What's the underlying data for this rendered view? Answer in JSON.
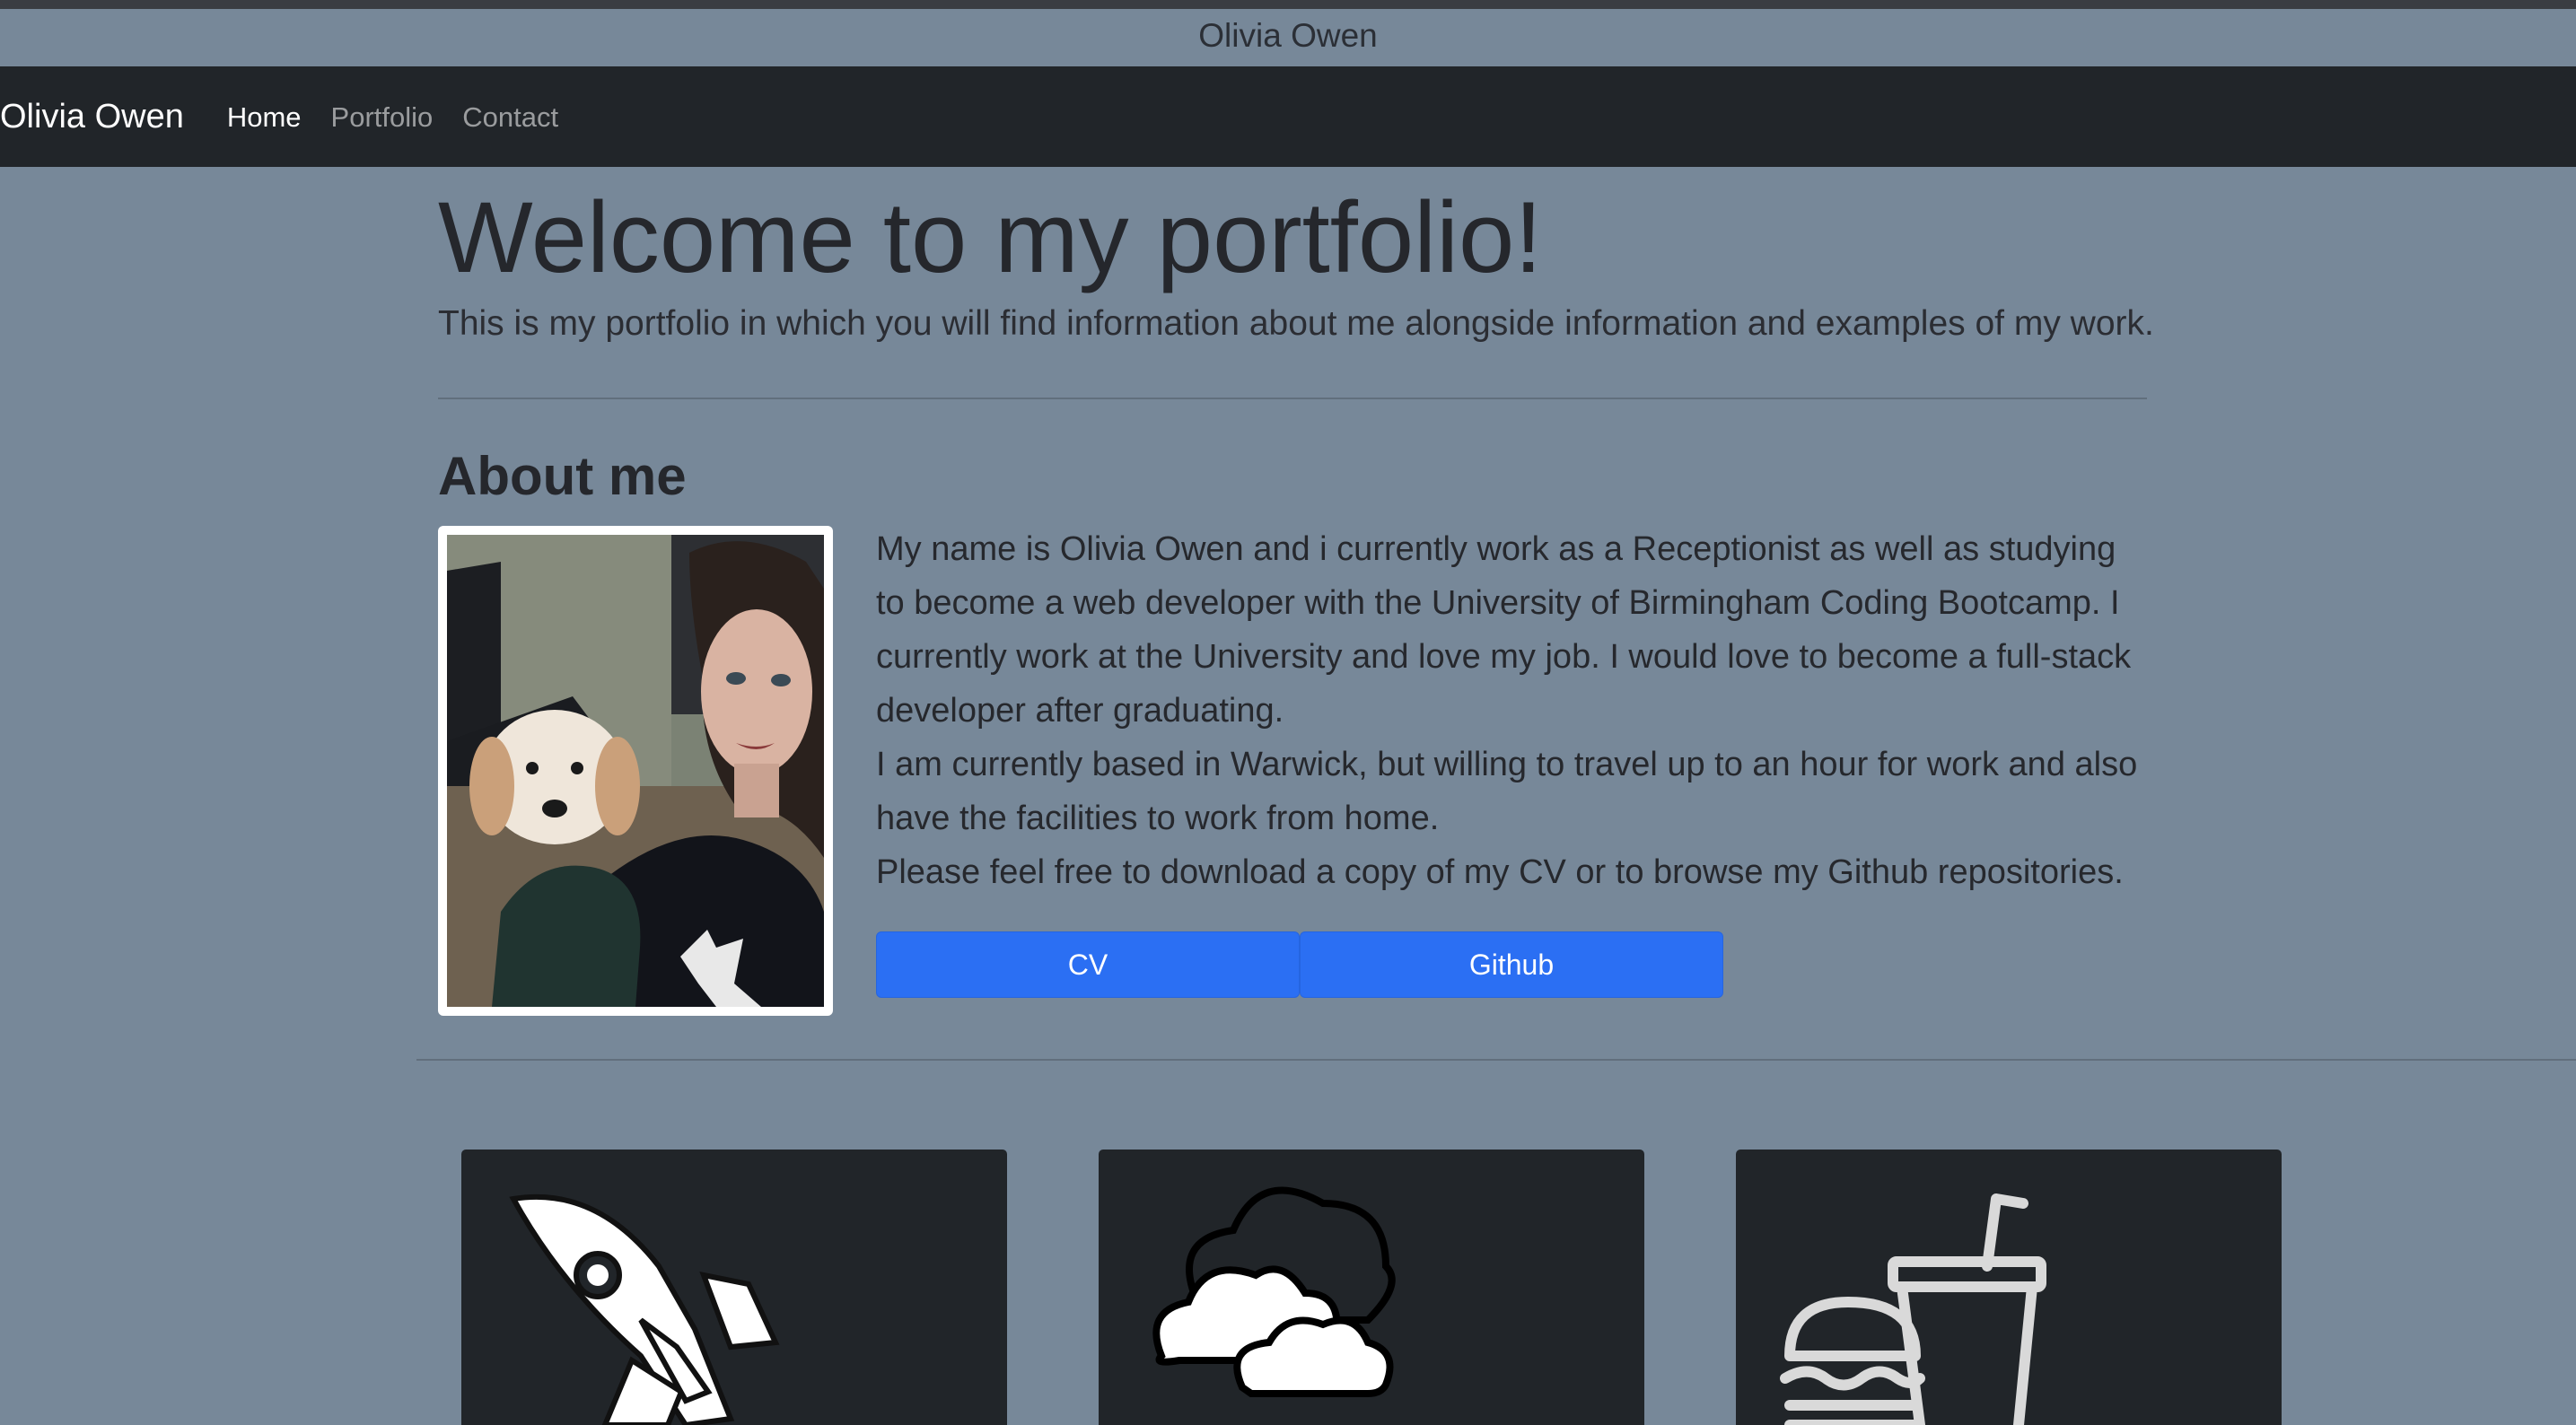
{
  "page_title": "Olivia Owen",
  "navbar": {
    "brand": "Olivia Owen",
    "links": [
      {
        "label": "Home",
        "active": true
      },
      {
        "label": "Portfolio",
        "active": false
      },
      {
        "label": "Contact",
        "active": false
      }
    ]
  },
  "hero": {
    "title": "Welcome to my portfolio!",
    "lead": "This is my portfolio in which you will find information about me alongside information and examples of my work."
  },
  "about": {
    "title": "About me",
    "paragraphs": [
      "My name is Olivia Owen and i currently work as a Receptionist as well as studying to become a web developer with the University of Birmingham Coding Bootcamp. I currently work at the University and love my job. I would love to become a full-stack developer after graduating.",
      "I am currently based in Warwick, but willing to travel up to an hour for work and also have the facilities to work from home.",
      "Please feel free to download a copy of my CV or to browse my Github repositories."
    ],
    "buttons": {
      "cv": "CV",
      "github": "Github"
    }
  },
  "cards": [
    {
      "icon": "rocket-icon"
    },
    {
      "icon": "cloud-icon"
    },
    {
      "icon": "burger-drink-icon"
    }
  ],
  "colors": {
    "background": "#778899",
    "navbar": "#212529",
    "button": "#2b6ff3",
    "card": "#212529"
  }
}
